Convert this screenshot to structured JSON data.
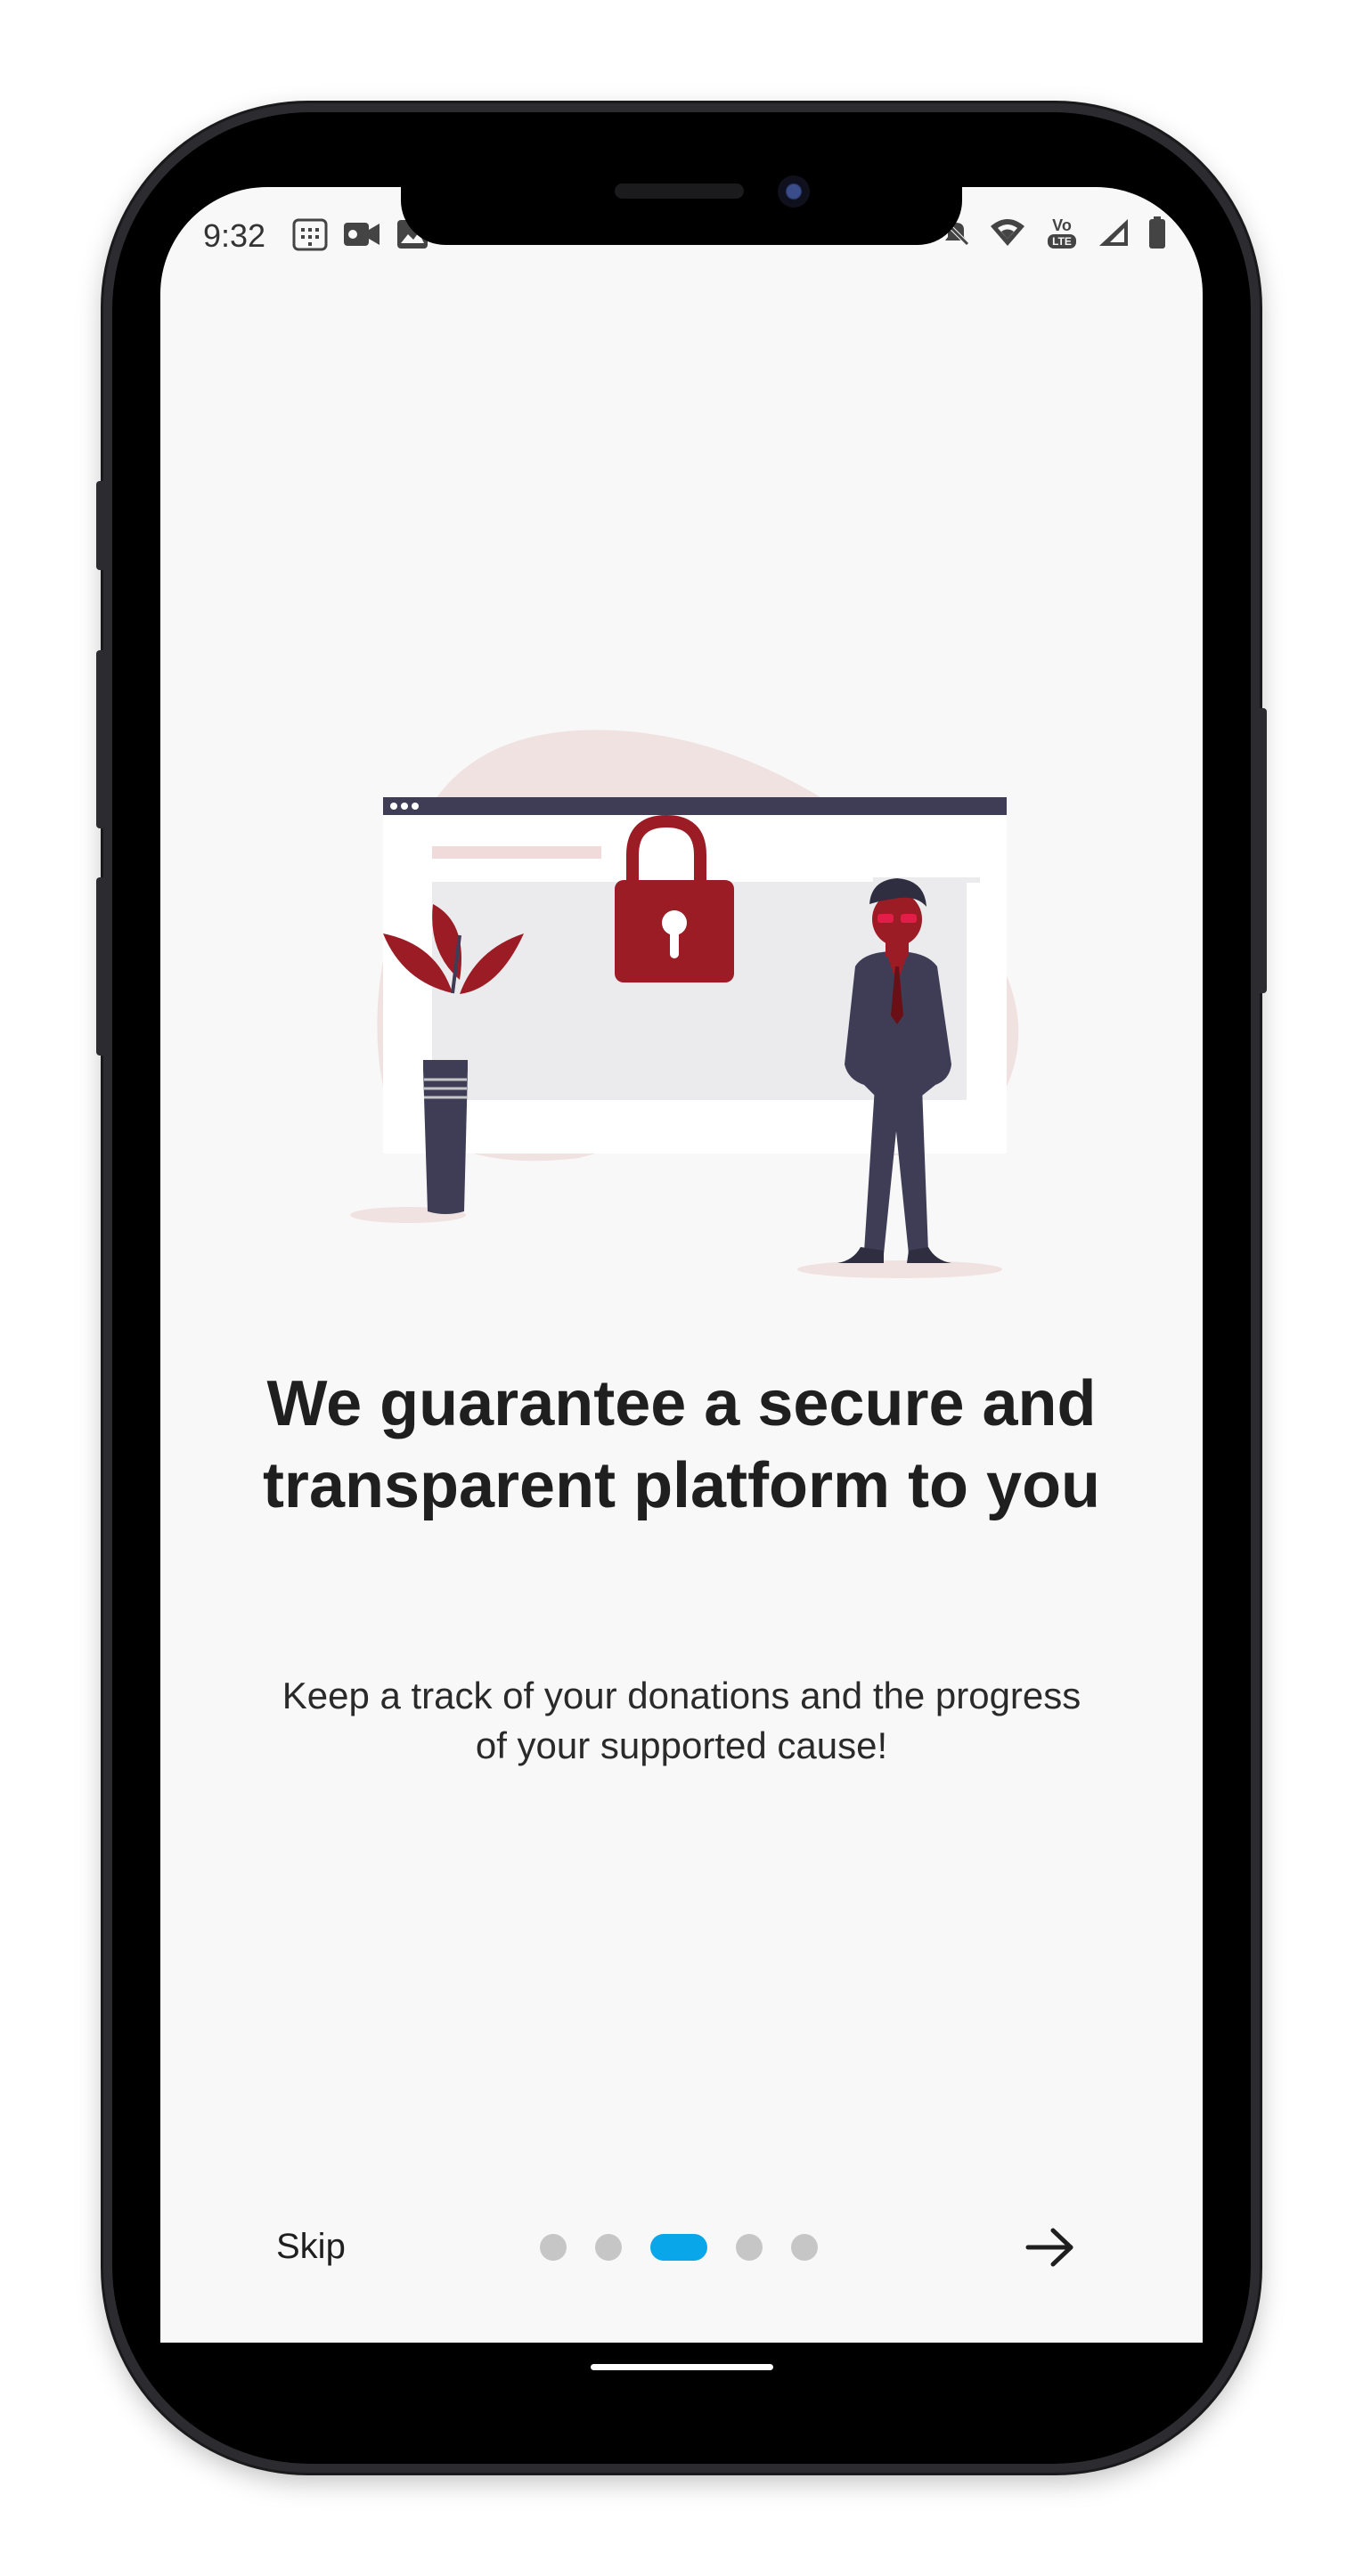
{
  "status_bar": {
    "time": "9:32",
    "left_icons": [
      "calendar-icon",
      "video-camera-icon",
      "image-icon"
    ],
    "right_icons": [
      "mute-icon",
      "wifi-icon",
      "volte-icon",
      "signal-icon",
      "battery-icon"
    ],
    "volte_label_top": "Vo",
    "volte_label_bottom": "LTE"
  },
  "onboarding": {
    "title": "We guarantee a secure and transparent platform to you",
    "subtitle": "Keep a track of your donations and the progress of your supported cause!",
    "page_count": 5,
    "active_page": 3
  },
  "footer": {
    "skip_label": "Skip",
    "next_icon": "arrow-right-icon"
  },
  "colors": {
    "accent": "#0aa6ea",
    "illustration_red": "#9b1c24",
    "illustration_dark": "#3f3d56",
    "blob_pink": "#f1e2e2",
    "background": "#f8f8f8"
  }
}
